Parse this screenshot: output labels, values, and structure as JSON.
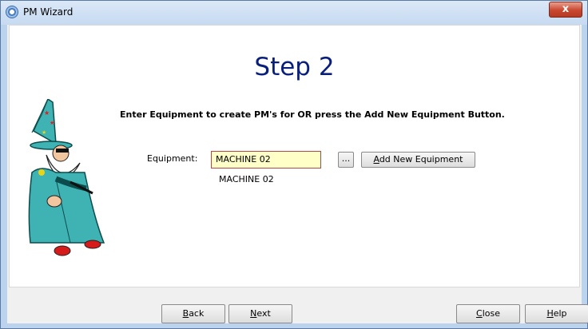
{
  "window": {
    "title": "PM Wizard",
    "close_glyph": "x"
  },
  "page": {
    "step_title": "Step 2",
    "instruction": "Enter Equipment to create PM's for OR press the Add New Equipment Button.",
    "equipment_label": "Equipment:",
    "equipment_value": "MACHINE 02",
    "equipment_description": "MACHINE 02",
    "browse_label": "...",
    "add_new_parts": [
      "",
      "A",
      "dd New Equipment"
    ]
  },
  "footer": {
    "back_parts": [
      "",
      "B",
      "ack"
    ],
    "next_parts": [
      "",
      "N",
      "ext"
    ],
    "close_parts": [
      "",
      "C",
      "lose"
    ],
    "help_parts": [
      "",
      "H",
      "elp"
    ]
  },
  "icons": {
    "app": "wizard-app-icon",
    "close": "close-icon",
    "mascot": "wizard-mascot-icon"
  },
  "colors": {
    "step_title": "#0a1f7c",
    "input_bg": "#ffffc8",
    "input_border": "#b04a4a",
    "close_button": "#c9462f"
  }
}
